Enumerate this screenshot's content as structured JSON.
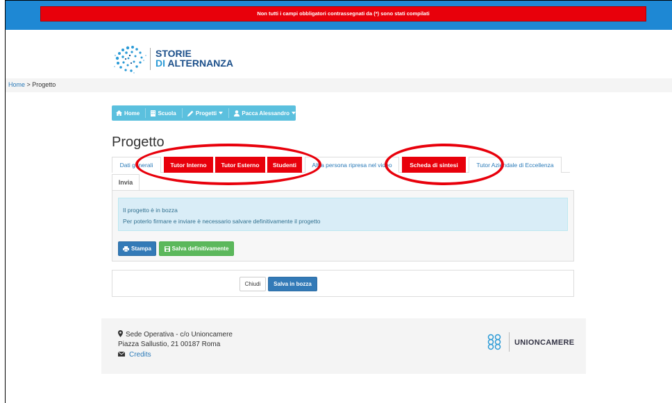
{
  "alert": {
    "message": "Non tutti i campi obbligatori contrassegnati da (*) sono stati compilati"
  },
  "logo": {
    "line1": "STORIE",
    "line2_prefix": "DI",
    "line2_rest": "ALTERNANZA"
  },
  "breadcrumb": {
    "home": "Home",
    "separator": " > ",
    "current": "Progetto"
  },
  "navbar": {
    "items": [
      {
        "label": "Home",
        "icon": "home-icon"
      },
      {
        "label": "Scuola",
        "icon": "building-icon"
      },
      {
        "label": "Progetti",
        "icon": "pencil-icon",
        "dropdown": true
      },
      {
        "label": "Pacca Alessandro",
        "icon": "user-icon",
        "dropdown": true
      }
    ]
  },
  "page": {
    "title": "Progetto"
  },
  "tabs": [
    {
      "label": "Dati generali",
      "state": "normal"
    },
    {
      "label": "Tutor Interno",
      "state": "error"
    },
    {
      "label": "Tutor Esterno",
      "state": "error"
    },
    {
      "label": "Studenti",
      "state": "error"
    },
    {
      "label": "Altra persona ripresa nel video",
      "state": "normal"
    },
    {
      "label": "Scheda di sintesi",
      "state": "error"
    },
    {
      "label": "Tutor Aziendale di Eccellenza",
      "state": "normal"
    }
  ],
  "second_tab": {
    "label": "Invia",
    "state": "active"
  },
  "info_box": {
    "line1": "Il progetto è in bozza",
    "line2": "Per poterlo firmare e inviare è necessario salvare definitivamente il progetto"
  },
  "actions": {
    "print": "Stampa",
    "save_final": "Salva definitivamente"
  },
  "bottom_actions": {
    "close": "Chiudi",
    "save_draft": "Salva in bozza"
  },
  "footer": {
    "address_line1": "Sede Operativa - c/o Unioncamere",
    "address_line2": "Piazza Sallustio, 21 00187 Roma",
    "credits": "Credits",
    "brand": "UNIONCAMERE"
  },
  "colors": {
    "topbar": "#1e88d4",
    "alert": "#e8000b",
    "nav": "#5bc0de",
    "primary": "#337ab7",
    "success": "#5cb85c",
    "info_bg": "#d9edf7"
  }
}
